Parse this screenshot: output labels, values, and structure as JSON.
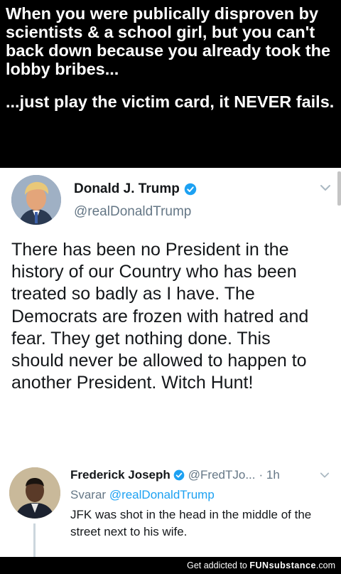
{
  "caption": {
    "line1": "When you were publically disproven by scientists & a school girl, but you can't back down because you already took the lobby bribes...",
    "line2": "...just play the victim card, it NEVER fails."
  },
  "tweet": {
    "author_name": "Donald J. Trump",
    "author_handle": "@realDonaldTrump",
    "text": "There has been no President in the history of our Country who has been treated so badly as I have. The Democrats are frozen with hatred and fear. They get nothing done. This should never be allowed to happen to another President. Witch Hunt!"
  },
  "reply": {
    "author_name": "Frederick Joseph",
    "author_handle": "@FredTJo...",
    "time": "· 1h",
    "replying_label": "Svarar",
    "replying_to": "@realDonaldTrump",
    "text": "JFK was shot in the head in the middle of the street next to his wife."
  },
  "footer": {
    "prefix": "Get addicted to",
    "brand": "FUNsubstance",
    "suffix": ".com"
  },
  "colors": {
    "verified_badge": "#1da1f2",
    "link": "#1da1f2",
    "secondary_text": "#657786"
  },
  "icons": [
    "verified-badge-icon",
    "chevron-down-icon",
    "avatar"
  ]
}
